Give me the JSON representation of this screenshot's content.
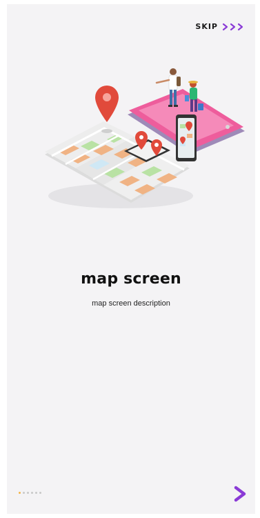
{
  "header": {
    "skip_label": "SKIP",
    "skip_icon": "triple-chevron-right-icon"
  },
  "slide": {
    "title": "map screen",
    "description": "map screen description",
    "illustration": "map-illustration"
  },
  "pagination": {
    "total": 6,
    "active_index": 0
  },
  "footer": {
    "next_icon": "chevron-right-icon"
  },
  "colors": {
    "background": "#f4f3f5",
    "accent_purple": "#8a3ad6",
    "active_dot": "#f4b548",
    "inactive_dot": "#c9c9c9",
    "pin_red": "#e14a3b",
    "phone_pink": "#ee5d9c"
  }
}
